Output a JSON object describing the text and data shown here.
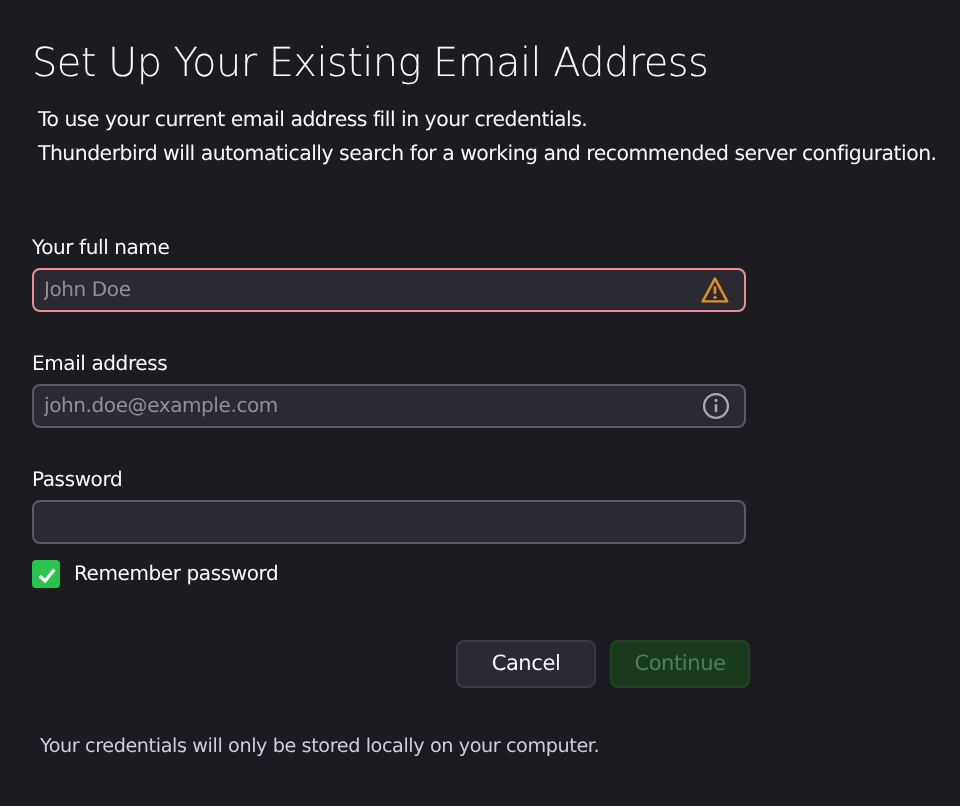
{
  "title": "Set Up Your Existing Email Address",
  "intro": [
    "To use your current email address fill in your credentials.",
    "Thunderbird will automatically search for a working and recommended server configuration."
  ],
  "fields": [
    {
      "label": "Your full name",
      "placeholder": "John Doe",
      "invalid": true,
      "info": false
    },
    {
      "label": "Email address",
      "placeholder": "john.doe@example.com",
      "invalid": false,
      "info": true
    },
    {
      "label": "Password",
      "invalid": false,
      "info": false
    }
  ],
  "remember": {
    "label": "Remember password",
    "checked": true
  },
  "buttons": [
    {
      "label": "Cancel",
      "kind": "secondary",
      "disabled": false
    },
    {
      "label": "Continue",
      "kind": "primary",
      "disabled": true
    }
  ],
  "footer": "Your credentials will only be stored locally on your computer."
}
